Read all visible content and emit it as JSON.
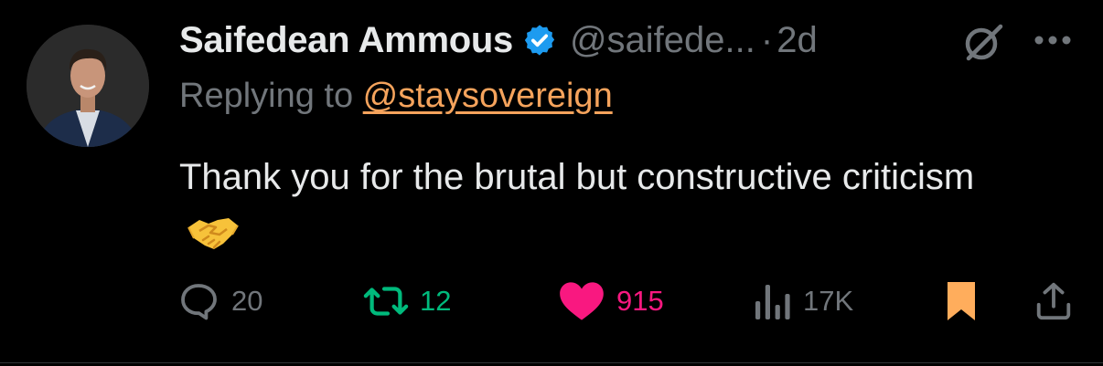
{
  "tweet": {
    "author_name": "Saifedean Ammous",
    "author_handle": "@saifede...",
    "separator": "·",
    "timestamp": "2d",
    "replying_prefix": "Replying to ",
    "replying_to": "@staysovereign",
    "text": "Thank you for the brutal but constructive criticism",
    "emoji": "handshake"
  },
  "actions": {
    "replies": "20",
    "retweets": "12",
    "likes": "915",
    "views": "17K",
    "liked": true,
    "bookmarked": true
  },
  "icons": {
    "verified": "verified-badge-icon",
    "grok": "grok-icon",
    "more": "more-icon",
    "reply": "reply-icon",
    "retweet": "retweet-icon",
    "like": "heart-icon",
    "views": "views-icon",
    "bookmark": "bookmark-icon",
    "share": "share-icon"
  },
  "colors": {
    "background": "#000000",
    "text": "#e7e9ea",
    "secondary": "#71767b",
    "verified": "#1d9bf0",
    "mention": "#f5a35c",
    "retweet": "#00ba7c",
    "like": "#f91880",
    "bookmark": "#ffad5c"
  }
}
